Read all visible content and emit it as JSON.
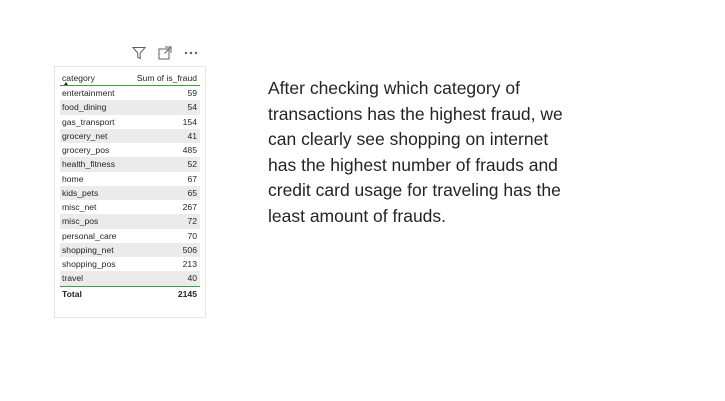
{
  "toolbar": {
    "icons": [
      "filter-icon",
      "focus-mode-icon",
      "more-options-icon"
    ]
  },
  "table": {
    "columns": [
      "category",
      "Sum of is_fraud"
    ],
    "rows": [
      {
        "category": "entertainment",
        "value": "59"
      },
      {
        "category": "food_dining",
        "value": "54"
      },
      {
        "category": "gas_transport",
        "value": "154"
      },
      {
        "category": "grocery_net",
        "value": "41"
      },
      {
        "category": "grocery_pos",
        "value": "485"
      },
      {
        "category": "health_fitness",
        "value": "52"
      },
      {
        "category": "home",
        "value": "67"
      },
      {
        "category": "kids_pets",
        "value": "65"
      },
      {
        "category": "misc_net",
        "value": "267"
      },
      {
        "category": "misc_pos",
        "value": "72"
      },
      {
        "category": "personal_care",
        "value": "70"
      },
      {
        "category": "shopping_net",
        "value": "506"
      },
      {
        "category": "shopping_pos",
        "value": "213"
      },
      {
        "category": "travel",
        "value": "40"
      }
    ],
    "total_label": "Total",
    "total_value": "2145"
  },
  "narrative": {
    "text": "After checking which category of transactions has the highest fraud, we can clearly see shopping on internet has the highest number of frauds and credit card usage for traveling has the least amount of frauds."
  },
  "colors": {
    "accent_line": "#3f9f3f",
    "alt_row": "#ebebeb",
    "text": "#252423"
  }
}
